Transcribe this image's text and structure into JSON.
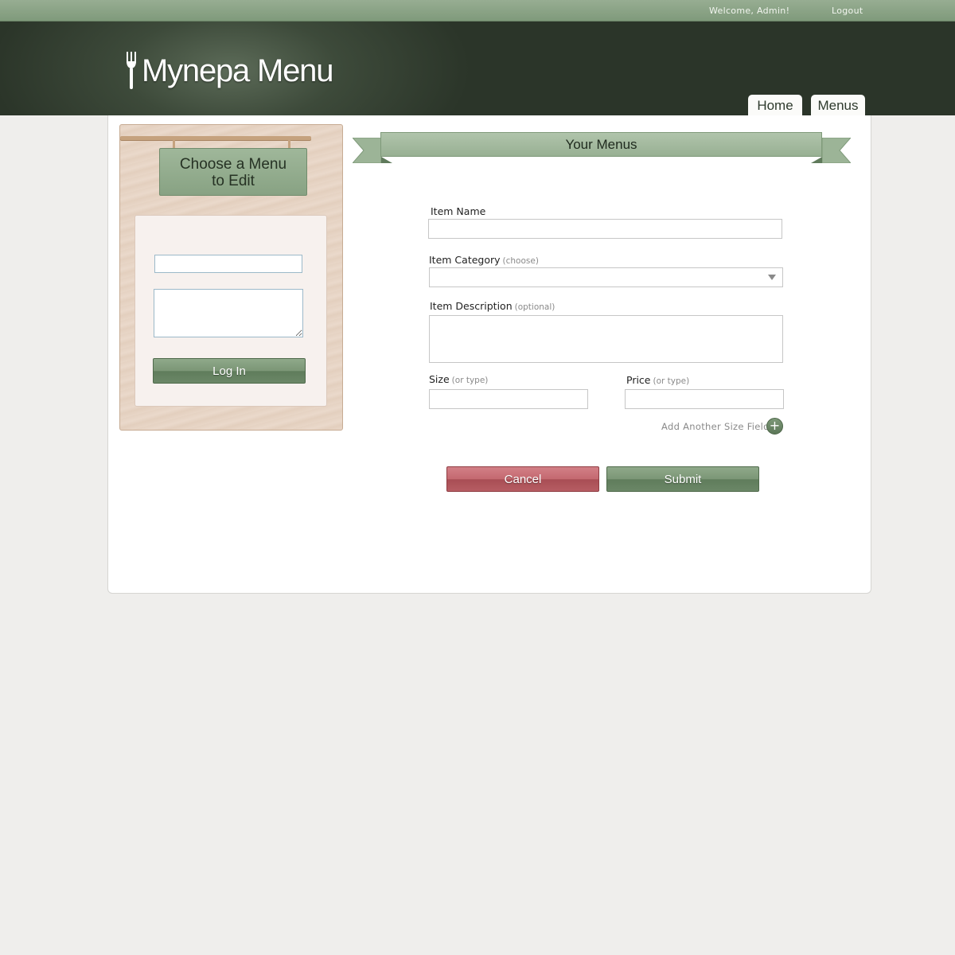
{
  "topbar": {
    "welcome": "Welcome, Admin!",
    "logout": "Logout"
  },
  "header": {
    "brand": "Mynepa Menu",
    "tabs": [
      {
        "label": "Home"
      },
      {
        "label": "Menus"
      }
    ]
  },
  "sidebar": {
    "sign_line1": "Choose a Menu",
    "sign_line2": "to Edit",
    "login_button": "Log In"
  },
  "main": {
    "title": "Your Menus",
    "form": {
      "item_name_label": "Item Name",
      "item_category_label": "Item Category",
      "item_category_hint": "(choose)",
      "item_description_label": "Item Description",
      "item_description_hint": "(optional)",
      "size_label": "Size",
      "size_hint": "(or type)",
      "price_label": "Price",
      "price_hint": "(or type)",
      "add_size_label": "Add Another Size Field",
      "cancel_label": "Cancel",
      "submit_label": "Submit"
    }
  },
  "colors": {
    "accent_green": "#7b9676",
    "cancel_red": "#c46970",
    "header_dark": "#2b3529"
  }
}
